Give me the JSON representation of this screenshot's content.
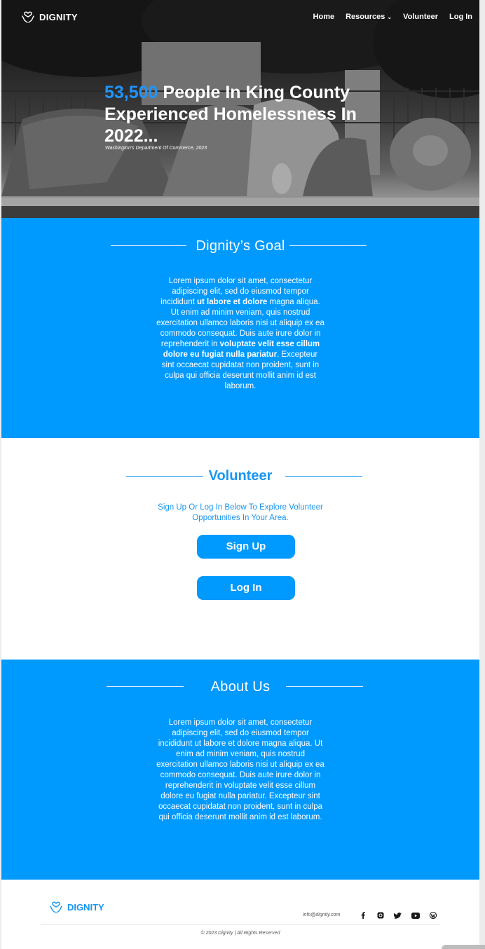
{
  "nav": {
    "brand": "DIGNITY",
    "items": [
      {
        "label": "Home"
      },
      {
        "label": "Resources",
        "dropdown": true
      },
      {
        "label": "Volunteer"
      },
      {
        "label": "Log In"
      }
    ]
  },
  "hero": {
    "headline_number": "53,500",
    "headline_rest": "People In King County Experienced Homelessness In 2022...",
    "source": "Washington's Department Of Commerce, 2023"
  },
  "goal": {
    "title": "Dignity’s Goal",
    "text_1": "Lorem ipsum dolor sit amet, consectetur adipiscing elit, sed do eiusmod tempor incididunt ",
    "bold_1": "ut labore et dolore",
    "text_2": " magna aliqua. Ut enim ad minim veniam, quis nostrud exercitation ullamco laboris nisi ut aliquip ex ea commodo consequat. Duis aute irure dolor in reprehenderit in ",
    "bold_2": "voluptate velit esse cillum dolore eu fugiat nulla pariatur",
    "text_3": ". Excepteur sint occaecat cupidatat non proident, sunt in culpa qui officia deserunt mollit anim id est laborum."
  },
  "volunteer": {
    "title": "Volunteer",
    "subtitle": "Sign Up Or Log In Below To Explore Volunteer Opportunities In Your Area.",
    "signup_label": "Sign Up",
    "login_label": "Log In"
  },
  "about": {
    "title": "About Us",
    "text": "Lorem ipsum dolor sit amet, consectetur adipiscing elit, sed do eiusmod tempor incididunt ut labore et dolore magna aliqua. Ut enim ad minim veniam, quis nostrud exercitation ullamco laboris nisi ut aliquip ex ea commodo consequat. Duis aute irure dolor in reprehenderit in voluptate velit esse cillum dolore eu fugiat nulla pariatur. Excepteur sint occaecat cupidatat non proident, sunt in culpa qui officia deserunt mollit anim id est laborum."
  },
  "footer": {
    "brand": "DIGNITY",
    "email": "info@dignity.com",
    "socials": [
      "facebook-icon",
      "instagram-icon",
      "twitter-icon",
      "youtube-icon",
      "wordpress-icon"
    ],
    "copyright": "© 2023 Dignity | All Rights Reserved"
  },
  "colors": {
    "brand_blue": "#0099fe",
    "text_blue": "#1a96f0",
    "white": "#ffffff"
  }
}
